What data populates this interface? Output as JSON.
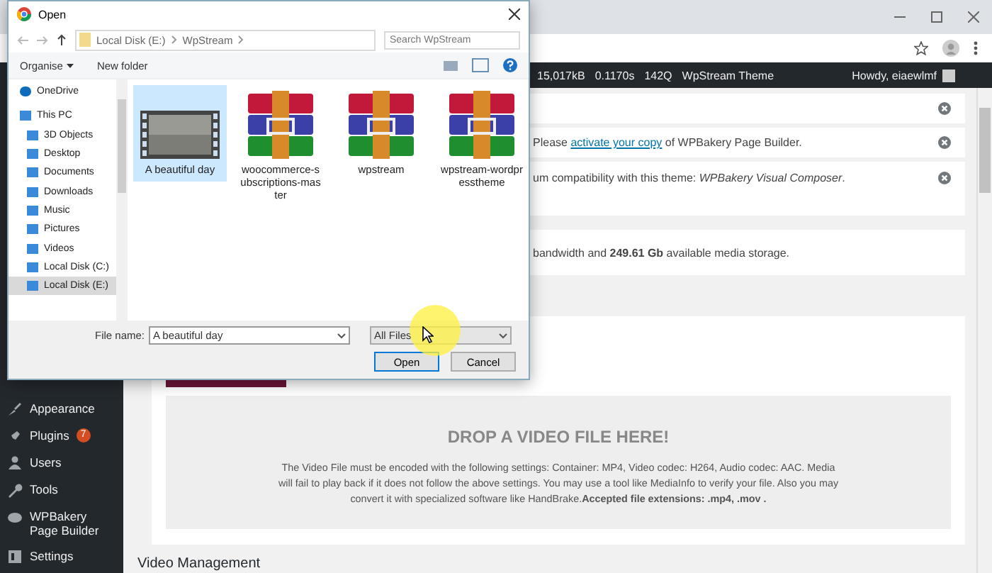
{
  "admin_bar": {
    "stats": [
      "15,017kB",
      "0.1170s",
      "142Q"
    ],
    "site": "WpStream Theme",
    "greeting": "Howdy, eiaewlmf"
  },
  "sidebar": {
    "items": [
      {
        "label": "Appearance"
      },
      {
        "label": "Plugins",
        "badge": "7"
      },
      {
        "label": "Users"
      },
      {
        "label": "Tools"
      },
      {
        "label": "WPBakery Page Builder"
      },
      {
        "label": "Settings"
      }
    ]
  },
  "notices": [
    {
      "dismissible": true
    },
    {
      "dismissible": true,
      "parts": [
        {
          "text": "Please "
        },
        {
          "text": "activate your copy",
          "link": true
        },
        {
          "text": " of WPBakery Page Builder."
        }
      ]
    },
    {
      "dismissible": true,
      "parts": [
        {
          "text": "um compatibility with this theme: *WPBakery Visual Composer*."
        }
      ]
    },
    {
      "dismissible": false,
      "parts": [
        {
          "text": "bandwidth and **249.61 Gb** available media storage."
        }
      ]
    }
  ],
  "upload": {
    "drop_title": "DROP A VIDEO FILE HERE!",
    "instructions": "The Video File must be encoded with the following settings: Container: MP4, Video codec: H264, Audio codec: AAC. Media will fail to play back if it does not follow the above settings. You may use a tool like MediaInfo to verify your file. Also you may convert it with specialized software like HandBrake.**Accepted file extensions: .mp4, .mov .**"
  },
  "section_heading": "Video Management",
  "dialog": {
    "title": "Open",
    "breadcrumb": [
      "Local Disk (E:)",
      "WpStream"
    ],
    "search": {
      "placeholder": "Search WpStream"
    },
    "toolbar": {
      "organise": "Organise",
      "new_folder": "New folder"
    },
    "nav": [
      {
        "label": "OneDrive",
        "selected": false
      },
      {
        "label": "This PC",
        "selected": false,
        "children": [
          {
            "label": "3D Objects",
            "selected": false
          },
          {
            "label": "Desktop",
            "selected": false
          },
          {
            "label": "Documents",
            "selected": false
          },
          {
            "label": "Downloads",
            "selected": false
          },
          {
            "label": "Music",
            "selected": false
          },
          {
            "label": "Pictures",
            "selected": false
          },
          {
            "label": "Videos",
            "selected": false
          },
          {
            "label": "Local Disk (C:)",
            "selected": false
          },
          {
            "label": "Local Disk (E:)",
            "selected": true
          }
        ]
      }
    ],
    "files": [
      {
        "name": "A beautiful day",
        "kind": "video",
        "selected": true
      },
      {
        "name": "woocommerce-subscriptions-master",
        "kind": "archive",
        "selected": false
      },
      {
        "name": "wpstream",
        "kind": "archive",
        "selected": false
      },
      {
        "name": "wpstream-wordpresstheme",
        "kind": "archive",
        "selected": false
      }
    ],
    "file_name_label": "File name:",
    "file_name": "A beautiful day",
    "filter": "All Files",
    "buttons": [
      {
        "label": "Open",
        "default": true
      },
      {
        "label": "Cancel",
        "default": false
      }
    ]
  }
}
